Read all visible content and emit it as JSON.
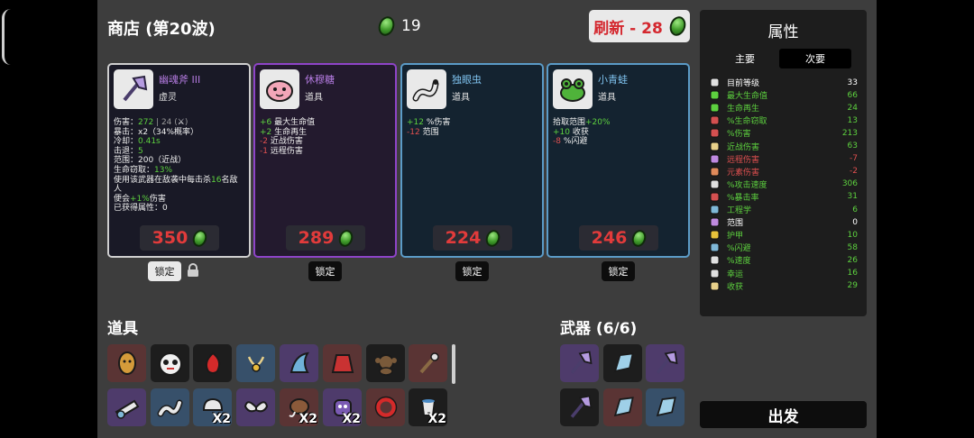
{
  "header": {
    "shop_title": "商店 (第20波)",
    "materials": "19",
    "refresh_label": "刷新 - 28"
  },
  "cards": [
    {
      "name": "幽魂斧 III",
      "type": "虚灵",
      "icon": "ghost-axe-icon",
      "price": "350",
      "lines": [
        [
          "伤害：",
          "272",
          " | 24 (",
          "⚔",
          ")"
        ],
        [
          "暴击：x2（34%概率）"
        ],
        [
          "冷却：",
          "0.41s"
        ],
        [
          "击退：",
          "5"
        ],
        [
          "范围：200（近战）"
        ],
        [
          "生命窃取：",
          "13%"
        ],
        [
          "使用该武器在敌袭中每击杀",
          "16",
          "名敌人"
        ],
        [
          "便会",
          "+1%",
          "伤害"
        ],
        [
          "已获得属性：0"
        ]
      ]
    },
    {
      "name": "休穆糖",
      "type": "道具",
      "icon": "candy-creature-icon",
      "price": "289",
      "lines": [
        [
          "+6",
          " 最大生命值"
        ],
        [
          "+2",
          " 生命再生"
        ],
        [
          "-2",
          " 近战伤害"
        ],
        [
          "-1",
          " 远程伤害"
        ]
      ]
    },
    {
      "name": "独眼虫",
      "type": "道具",
      "icon": "one-eyed-worm-icon",
      "price": "224",
      "lines": [
        [
          "+12",
          " %伤害"
        ],
        [
          "-12",
          " 范围"
        ]
      ]
    },
    {
      "name": "小青蛙",
      "type": "道具",
      "icon": "frog-icon",
      "price": "246",
      "lines": [
        [
          "拾取范围",
          "+20%"
        ],
        [
          "+10",
          " 收获"
        ],
        [
          "-8",
          " %闪避"
        ]
      ]
    }
  ],
  "lock_label": "锁定",
  "items_title": "道具",
  "items": [
    {
      "icon": "potato-icon",
      "count": ""
    },
    {
      "icon": "panda-mask-icon",
      "count": ""
    },
    {
      "icon": "red-flame-icon",
      "count": ""
    },
    {
      "icon": "necklace-icon",
      "count": ""
    },
    {
      "icon": "shark-fin-icon",
      "count": ""
    },
    {
      "icon": "red-cape-icon",
      "count": ""
    },
    {
      "icon": "monkey-icon",
      "count": ""
    },
    {
      "icon": "torch-icon",
      "count": ""
    },
    {
      "icon": "cannon-icon",
      "count": ""
    },
    {
      "icon": "worm-icon",
      "count": ""
    },
    {
      "icon": "helmet-icon",
      "count": "X2"
    },
    {
      "icon": "wings-icon",
      "count": ""
    },
    {
      "icon": "mammoth-icon",
      "count": "X2"
    },
    {
      "icon": "purple-monster-icon",
      "count": "X2"
    },
    {
      "icon": "red-ring-icon",
      "count": ""
    },
    {
      "icon": "bucket-icon",
      "count": "X2"
    }
  ],
  "weapons_title": "武器 (6/6)",
  "weapons": [
    {
      "icon": "ghost-axe-icon"
    },
    {
      "icon": "ghost-flint-icon"
    },
    {
      "icon": "ghost-axe-icon"
    },
    {
      "icon": "ghost-axe-icon"
    },
    {
      "icon": "ghost-flint-icon"
    },
    {
      "icon": "ghost-flint-icon"
    }
  ],
  "stats": {
    "title": "属性",
    "tab_primary": "主要",
    "tab_secondary": "次要",
    "rows": [
      {
        "icon": "level-icon",
        "label": "目前等级",
        "value": "33",
        "color": "#ffffff"
      },
      {
        "icon": "heart-icon",
        "label": "最大生命值",
        "value": "66",
        "color": "#5dd13f"
      },
      {
        "icon": "regen-icon",
        "label": "生命再生",
        "value": "24",
        "color": "#5dd13f"
      },
      {
        "icon": "lifesteal-icon",
        "label": "%生命窃取",
        "value": "13",
        "color": "#5dd13f"
      },
      {
        "icon": "damage-icon",
        "label": "%伤害",
        "value": "213",
        "color": "#5dd13f"
      },
      {
        "icon": "melee-icon",
        "label": "近战伤害",
        "value": "63",
        "color": "#5dd13f"
      },
      {
        "icon": "ranged-icon",
        "label": "远程伤害",
        "value": "-7",
        "color": "#e05050"
      },
      {
        "icon": "elemental-icon",
        "label": "元素伤害",
        "value": "-2",
        "color": "#e05050"
      },
      {
        "icon": "attack-speed-icon",
        "label": "%攻击速度",
        "value": "306",
        "color": "#5dd13f"
      },
      {
        "icon": "crit-icon",
        "label": "%暴击率",
        "value": "31",
        "color": "#5dd13f"
      },
      {
        "icon": "engineering-icon",
        "label": "工程学",
        "value": "6",
        "color": "#5dd13f"
      },
      {
        "icon": "range-icon",
        "label": "范围",
        "value": "0",
        "color": "#ffffff"
      },
      {
        "icon": "armor-icon",
        "label": "护甲",
        "value": "10",
        "color": "#5dd13f"
      },
      {
        "icon": "dodge-icon",
        "label": "%闪避",
        "value": "58",
        "color": "#5dd13f"
      },
      {
        "icon": "speed-icon",
        "label": "%速度",
        "value": "26",
        "color": "#5dd13f"
      },
      {
        "icon": "luck-icon",
        "label": "幸运",
        "value": "16",
        "color": "#5dd13f"
      },
      {
        "icon": "harvest-icon",
        "label": "收获",
        "value": "29",
        "color": "#5dd13f"
      }
    ]
  },
  "go_label": "出发"
}
